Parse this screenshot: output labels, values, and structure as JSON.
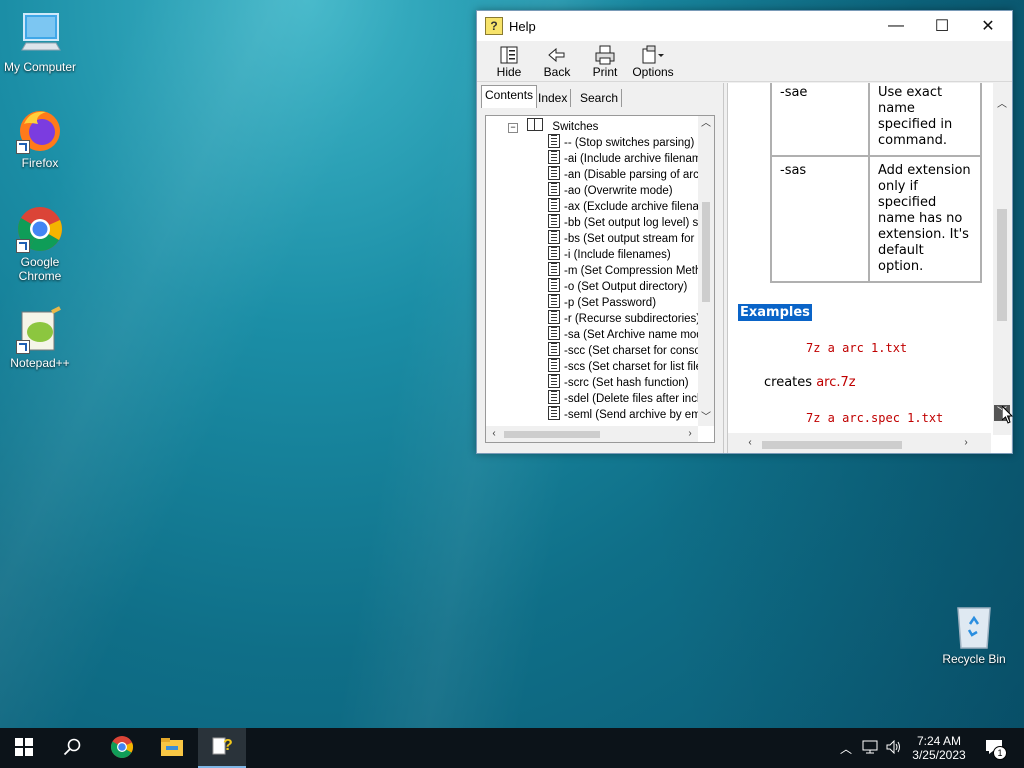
{
  "desktop": {
    "icons": [
      {
        "label": "My Computer"
      },
      {
        "label": "Firefox"
      },
      {
        "label": "Google Chrome"
      },
      {
        "label": "Notepad++"
      },
      {
        "label": "Recycle Bin"
      }
    ]
  },
  "window": {
    "title": "Help",
    "controls": {
      "minimize": "—",
      "maximize": "☐",
      "close": "✕"
    },
    "toolbar": [
      {
        "label": "Hide",
        "icon": "hide-icon"
      },
      {
        "label": "Back",
        "icon": "back-arrow-icon"
      },
      {
        "label": "Print",
        "icon": "printer-icon"
      },
      {
        "label": "Options",
        "icon": "options-icon"
      }
    ],
    "tabs": [
      {
        "label": "Contents",
        "active": true
      },
      {
        "label": "Index",
        "active": false
      },
      {
        "label": "Search",
        "active": false
      }
    ],
    "tree": {
      "folder": "Switches",
      "items": [
        "-- (Stop switches parsing)",
        "-ai (Include archive filenames)",
        "-an (Disable parsing of archive name)",
        "-ao (Overwrite mode)",
        "-ax (Exclude archive filenames)",
        "-bb (Set output log level) switch",
        "-bs (Set output stream for output/error/progress)",
        "-i (Include filenames)",
        "-m (Set Compression Method)",
        "-o (Set Output directory)",
        "-p (Set Password)",
        "-r (Recurse subdirectories)",
        "-sa (Set Archive name mode)",
        "-scc (Set charset for console input/output)",
        "-scs (Set charset for list files)",
        "-scrc (Set hash function)",
        "-sdel (Delete files after including to archive)",
        "-seml (Send archive by email)"
      ]
    },
    "content": {
      "rows": [
        {
          "switch": "-sae",
          "desc": "Use exact name specified in command."
        },
        {
          "switch": "-sas",
          "desc": "Add extension only if specified name has no extension. It's default option."
        }
      ],
      "examples_heading": "Examples",
      "example1": "7z a arc 1.txt",
      "creates_text": "creates",
      "creates_file": "arc.7z",
      "example2": "7z a arc.spec 1.txt"
    }
  },
  "taskbar": {
    "start": "start-icon",
    "search": "search-icon",
    "apps": [
      "chrome-icon",
      "file-explorer-icon",
      "help-icon"
    ],
    "time": "7:24 AM",
    "date": "3/25/2023",
    "notification_count": "1"
  },
  "colors": {
    "accent": "#0a64c8",
    "code_red": "#c00000",
    "taskbar": "#0c1319"
  }
}
